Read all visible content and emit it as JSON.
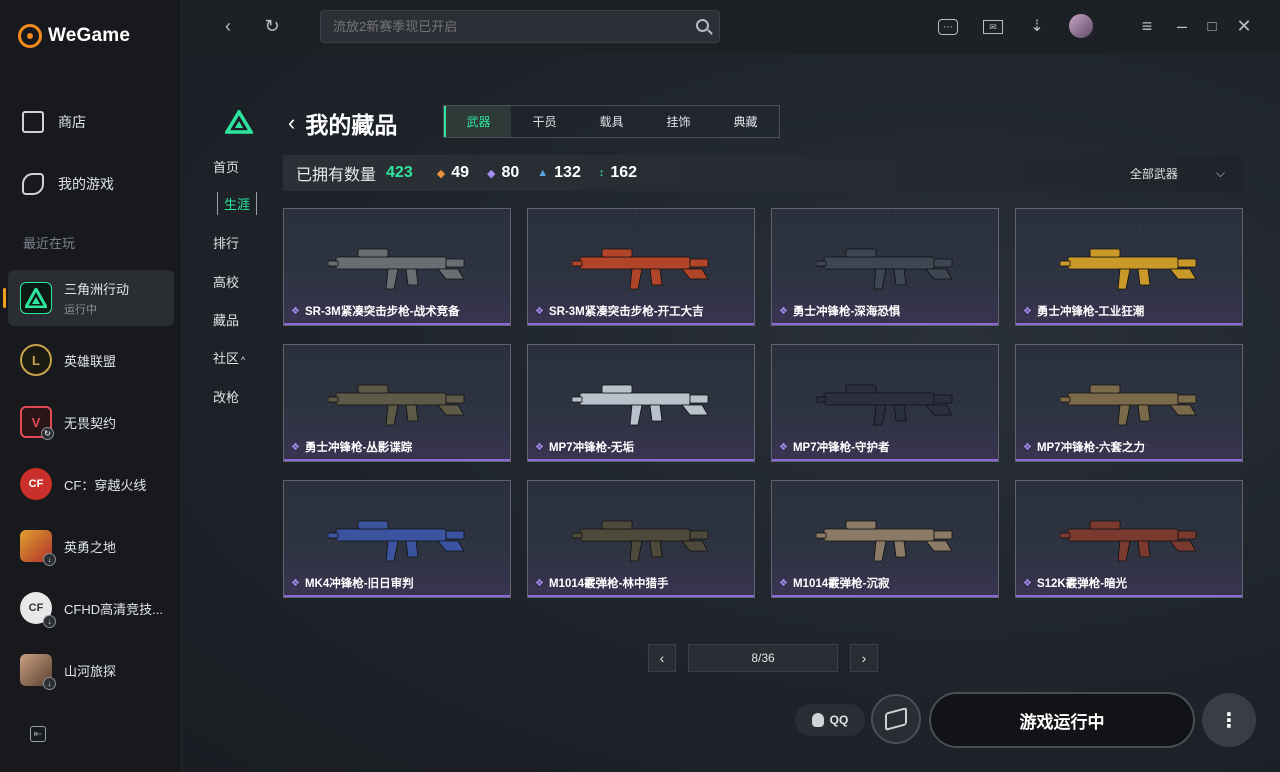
{
  "app": {
    "brand": "WeGame"
  },
  "sidebar": {
    "nav": [
      {
        "label": "商店",
        "icon": "store-bag-icon"
      },
      {
        "label": "我的游戏",
        "icon": "gamepad-icon"
      }
    ],
    "recent_label": "最近在玩",
    "games": [
      {
        "name": "三角洲行动",
        "status": "运行中",
        "icon": "delta-force-icon",
        "active": true
      },
      {
        "name": "英雄联盟",
        "status": "",
        "icon": "lol-icon"
      },
      {
        "name": "无畏契约",
        "status": "",
        "icon": "valorant-icon"
      },
      {
        "name": "CF：穿越火线",
        "status": "",
        "icon": "crossfire-icon"
      },
      {
        "name": "英勇之地",
        "status": "",
        "icon": "yingyong-icon"
      },
      {
        "name": "CFHD高清竞技...",
        "status": "",
        "icon": "cfhd-icon"
      },
      {
        "name": "山河旅探",
        "status": "",
        "icon": "shanhe-icon"
      }
    ]
  },
  "topbar": {
    "search_placeholder": "流放2新赛季现已开启"
  },
  "game_nav": [
    "首页",
    "生涯",
    "排行",
    "高校",
    "藏品",
    "社区",
    "改枪"
  ],
  "game_nav_active": "生涯",
  "page": {
    "title": "我的藏品",
    "tabs": [
      "武器",
      "干员",
      "载具",
      "挂饰",
      "典藏"
    ],
    "active_tab": "武器"
  },
  "stats": {
    "owned_label": "已拥有数量",
    "owned_count": "423",
    "rarities": [
      {
        "value": "49",
        "color": "#e8923a"
      },
      {
        "value": "80",
        "color": "#a88cf0"
      },
      {
        "value": "132",
        "color": "#5aa2e0"
      },
      {
        "value": "162",
        "color": "#2ee59d"
      }
    ],
    "filter_label": "全部武器"
  },
  "weapons": [
    {
      "name": "SR-3M紧凑突击步枪-战术竞备",
      "tone": "#6a6e72"
    },
    {
      "name": "SR-3M紧凑突击步枪-开工大吉",
      "tone": "#b0452a"
    },
    {
      "name": "勇士冲锋枪-深海恐惧",
      "tone": "#3e4654"
    },
    {
      "name": "勇士冲锋枪-工业狂潮",
      "tone": "#c99a2a"
    },
    {
      "name": "勇士冲锋枪-丛影谍踪",
      "tone": "#5d5a48"
    },
    {
      "name": "MP7冲锋枪-无垢",
      "tone": "#b8c2cc"
    },
    {
      "name": "MP7冲锋枪-守护者",
      "tone": "#2a3040"
    },
    {
      "name": "MP7冲锋枪-六套之力",
      "tone": "#7a6a4a"
    },
    {
      "name": "MK4冲锋枪-旧日审判",
      "tone": "#3a54a0"
    },
    {
      "name": "M1014霰弹枪-林中猎手",
      "tone": "#4d4a3c"
    },
    {
      "name": "M1014霰弹枪-沉寂",
      "tone": "#8a7a66"
    },
    {
      "name": "S12K霰弹枪-暗光",
      "tone": "#7a3a30"
    }
  ],
  "pager": {
    "text": "8/36"
  },
  "footer": {
    "qq_label": "QQ",
    "play_label": "游戏运行中"
  }
}
